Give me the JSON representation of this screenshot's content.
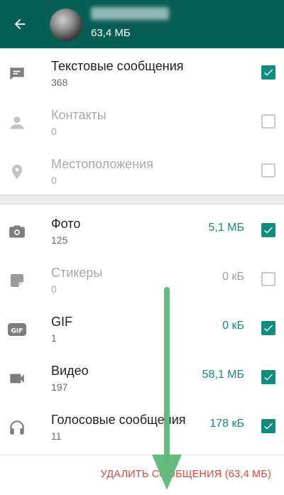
{
  "header": {
    "contact_size": "63,4 МБ"
  },
  "items": [
    {
      "title": "Текстовые сообщения",
      "count": "368",
      "size": "",
      "checked": true,
      "enabled": true
    },
    {
      "title": "Контакты",
      "count": "0",
      "size": "",
      "checked": false,
      "enabled": false
    },
    {
      "title": "Местоположения",
      "count": "0",
      "size": "",
      "checked": false,
      "enabled": false
    },
    {
      "title": "Фото",
      "count": "125",
      "size": "5,1 МБ",
      "checked": true,
      "enabled": true
    },
    {
      "title": "Стикеры",
      "count": "0",
      "size": "0 кБ",
      "checked": false,
      "enabled": false
    },
    {
      "title": "GIF",
      "count": "1",
      "size": "0 кБ",
      "checked": true,
      "enabled": true
    },
    {
      "title": "Видео",
      "count": "197",
      "size": "58,1 МБ",
      "checked": true,
      "enabled": true
    },
    {
      "title": "Голосовые сообщения",
      "count": "11",
      "size": "178 кБ",
      "checked": true,
      "enabled": true
    }
  ],
  "footer": {
    "delete_label": "УДАЛИТЬ СООБЩЕНИЯ (63,4 МБ)"
  },
  "colors": {
    "appbar": "#075e54",
    "accent": "#128c7e",
    "delete": "#e0463a",
    "annotation_arrow": "#5cb87a"
  }
}
